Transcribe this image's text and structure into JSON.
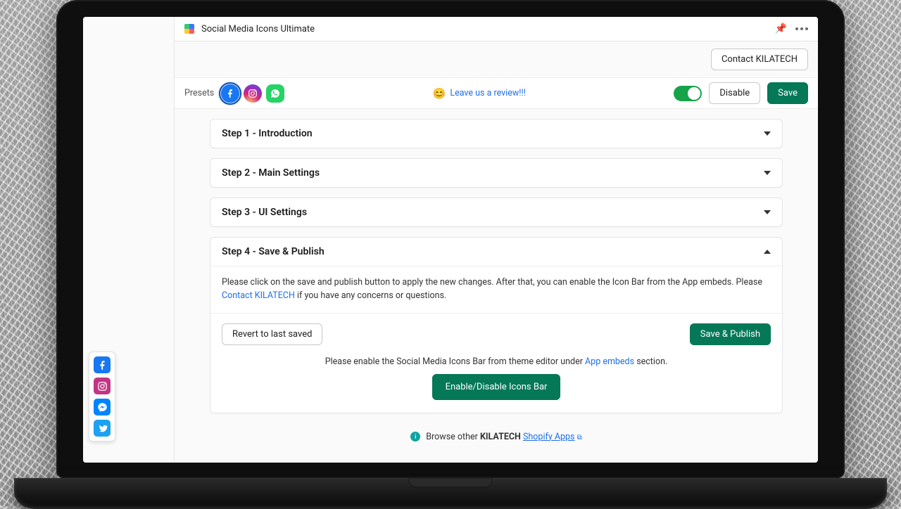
{
  "header": {
    "app_title": "Social Media Icons Ultimate"
  },
  "contact_button": "Contact KILATECH",
  "presets": {
    "label": "Presets",
    "icons": [
      "facebook",
      "instagram",
      "whatsapp"
    ],
    "selected": "facebook"
  },
  "review": {
    "text": "Leave us a review!!!"
  },
  "controls": {
    "enabled": true,
    "disable_label": "Disable",
    "save_label": "Save"
  },
  "steps": [
    {
      "title": "Step 1 - Introduction",
      "open": false
    },
    {
      "title": "Step 2 - Main Settings",
      "open": false
    },
    {
      "title": "Step 3 - UI Settings",
      "open": false
    },
    {
      "title": "Step 4 - Save & Publish",
      "open": true
    }
  ],
  "step4": {
    "note_before": "Please click on the save and publish button to apply the new changes. After that, you can enable the Icon Bar from the App embeds. Please ",
    "note_link": "Contact KILATECH",
    "note_after": " if you have any concerns or questions.",
    "revert_label": "Revert to last saved",
    "publish_label": "Save & Publish",
    "embed_before": "Please enable the Social Media Icons Bar from theme editor under ",
    "embed_link": "App embeds",
    "embed_after": " section.",
    "toggle_label": "Enable/Disable Icons Bar"
  },
  "footer": {
    "prefix": "Browse other ",
    "brand": "KILATECH",
    "link": "Shopify Apps"
  },
  "floatbar": [
    "facebook",
    "instagram",
    "messenger",
    "twitter"
  ]
}
